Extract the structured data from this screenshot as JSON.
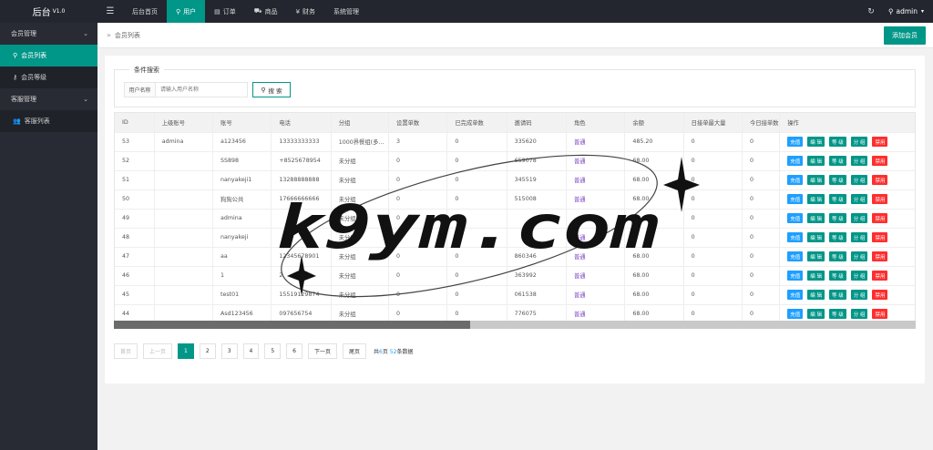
{
  "header": {
    "logo": "后台",
    "version": "V1.0",
    "menu_icon": "hamburger-icon",
    "nav": [
      {
        "label": "后台首页",
        "icon": ""
      },
      {
        "label": "用户",
        "icon": "user-icon",
        "active": true
      },
      {
        "label": "订单",
        "icon": "order-icon"
      },
      {
        "label": "商品",
        "icon": "cart-icon"
      },
      {
        "label": "财务",
        "icon": "yen-icon"
      },
      {
        "label": "系统管理",
        "icon": ""
      }
    ],
    "user": "admin"
  },
  "sidebar": {
    "groups": [
      {
        "label": "会员管理",
        "items": [
          {
            "label": "会员列表",
            "icon": "user-icon",
            "active": true
          },
          {
            "label": "会员等级",
            "icon": "key-icon"
          }
        ]
      },
      {
        "label": "客服管理",
        "items": [
          {
            "label": "客服列表",
            "icon": "users-icon"
          }
        ]
      }
    ]
  },
  "breadcrumb": {
    "current": "会员列表",
    "add_button": "添加会员"
  },
  "search": {
    "legend": "条件搜索",
    "label": "用户名称",
    "placeholder": "请输入用户名称",
    "button": "搜 索"
  },
  "table": {
    "columns": [
      "ID",
      "上级账号",
      "账号",
      "电话",
      "分组",
      "设置单数",
      "已完成单数",
      "邀请码",
      "角色",
      "余额",
      "日接单最大量",
      "今日接单数",
      "操作"
    ],
    "actions": [
      "充值",
      "编 辑",
      "等 级",
      "分 组",
      "禁用"
    ],
    "rows": [
      [
        "53",
        "admina",
        "a123456",
        "13333333333",
        "1000界餐组(多...",
        "3",
        "0",
        "335620",
        "普通",
        "485.20",
        "0",
        "0"
      ],
      [
        "52",
        "",
        "SS898",
        "+8525678954",
        "未分组",
        "0",
        "0",
        "659078",
        "普通",
        "68.00",
        "0",
        "0"
      ],
      [
        "51",
        "",
        "nanyakeji1",
        "13288888888",
        "未分组",
        "0",
        "0",
        "345519",
        "普通",
        "68.00",
        "0",
        "0"
      ],
      [
        "50",
        "",
        "狗狗公共",
        "17666666666",
        "未分组",
        "0",
        "0",
        "515008",
        "普通",
        "68.00",
        "0",
        "0"
      ],
      [
        "49",
        "",
        "admina",
        "",
        "未分组",
        "0",
        "0",
        "",
        "",
        "",
        "0",
        "0"
      ],
      [
        "48",
        "",
        "nanyakeji",
        "",
        "未分组",
        "0",
        "0",
        "",
        "普通",
        "",
        "0",
        "0"
      ],
      [
        "47",
        "",
        "aa",
        "12345678901",
        "未分组",
        "0",
        "0",
        "860346",
        "普通",
        "68.00",
        "0",
        "0"
      ],
      [
        "46",
        "",
        "1",
        "2",
        "未分组",
        "0",
        "0",
        "363992",
        "普通",
        "68.00",
        "0",
        "0"
      ],
      [
        "45",
        "",
        "test01",
        "15519129874",
        "未分组",
        "0",
        "0",
        "061538",
        "普通",
        "68.00",
        "0",
        "0"
      ],
      [
        "44",
        "",
        "Asd123456",
        "097656754",
        "未分组",
        "0",
        "0",
        "776075",
        "普通",
        "68.00",
        "0",
        "0"
      ]
    ]
  },
  "pager": {
    "first": "首页",
    "prev": "上一页",
    "pages": [
      "1",
      "2",
      "3",
      "4",
      "5",
      "6"
    ],
    "current": "1",
    "next": "下一页",
    "last": "尾页",
    "info_prefix": "共",
    "total_pages": "6",
    "info_mid": "页 ",
    "total_records": "52",
    "info_suffix": "条数据"
  },
  "watermark": "k9ym.com",
  "colors": {
    "accent": "#009688",
    "blue": "#1e9fff",
    "red": "#ff2e2e",
    "header_bg": "#23262e",
    "sidebar_bg": "#282b33"
  }
}
